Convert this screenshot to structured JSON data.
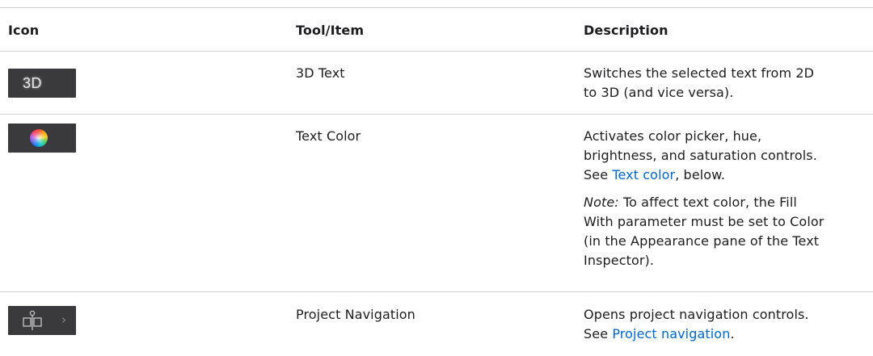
{
  "headers": {
    "icon": "Icon",
    "tool": "Tool/Item",
    "description": "Description"
  },
  "rows": [
    {
      "icon": {
        "name": "3d-text-icon",
        "label": "3D"
      },
      "tool": "3D Text",
      "desc_lines": [
        "Switches the selected text from 2D",
        "to 3D (and vice versa)."
      ]
    },
    {
      "icon": {
        "name": "color-wheel-icon"
      },
      "tool": "Text Color",
      "desc_lines": [
        "Activates color picker, hue,",
        "brightness, and saturation controls."
      ],
      "desc_prefix": "See ",
      "desc_link": "Text color",
      "desc_suffix": ", below.",
      "note_label": "Note:",
      "note_lines": [
        " To affect text color, the Fill",
        "With parameter must be set to Color",
        "(in the Appearance pane of the Text",
        "Inspector)."
      ]
    },
    {
      "icon": {
        "name": "project-navigation-icon",
        "chevron": "›"
      },
      "tool": "Project Navigation",
      "desc_lines": [
        "Opens project navigation controls."
      ],
      "desc_prefix": "See ",
      "desc_link": "Project navigation",
      "desc_suffix": "."
    }
  ],
  "colors": {
    "link": "#0066cc",
    "icon_background": "#3a3a3c",
    "rule": "#d2d2d7"
  }
}
